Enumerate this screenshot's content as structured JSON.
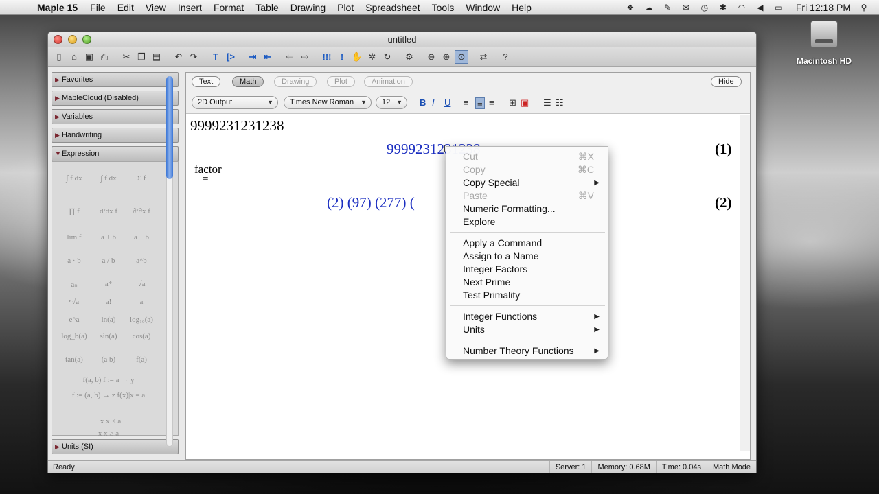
{
  "menubar": {
    "app_name": "Maple 15",
    "menus": [
      "File",
      "Edit",
      "View",
      "Insert",
      "Format",
      "Table",
      "Drawing",
      "Plot",
      "Spreadsheet",
      "Tools",
      "Window",
      "Help"
    ],
    "clock": "Fri 12:18 PM"
  },
  "desktop": {
    "drive_label": "Macintosh HD"
  },
  "window": {
    "title": "untitled"
  },
  "palette": {
    "sections": {
      "favorites": "Favorites",
      "maplecloud": "MapleCloud (Disabled)",
      "variables": "Variables",
      "handwriting": "Handwriting",
      "expression": "Expression",
      "units": "Units (SI)"
    },
    "expressions": [
      "∫ f dx",
      "∫ f dx",
      "Σ f",
      "∏ f",
      "d/dx f",
      "∂/∂x f",
      "lim f",
      "a + b",
      "a − b",
      "a · b",
      "a / b",
      "a^b",
      "aₙ",
      "a*",
      "√a",
      "ⁿ√a",
      "a!",
      "|a|",
      "e^a",
      "ln(a)",
      "log₁₀(a)",
      "log_b(a)",
      "sin(a)",
      "cos(a)",
      "tan(a)",
      "(a b)",
      "f(a)",
      "f(a, b)   f := a → y",
      "f := (a, b) → z   f(x)|x = a",
      "−x   x < a",
      "x   x ≥ a"
    ]
  },
  "context_bar": {
    "modes": [
      "Text",
      "Math",
      "Drawing",
      "Plot",
      "Animation"
    ],
    "hide": "Hide",
    "style": "2D Output",
    "font": "Times New Roman",
    "size": "12"
  },
  "document": {
    "input1": "9999231231238",
    "output1": "9999231231238",
    "label1": "(1)",
    "command": "factor",
    "equals": "=",
    "output2": "(2) (97) (277) (",
    "label2": "(2)"
  },
  "context_menu": {
    "cut": "Cut",
    "cut_sc": "⌘X",
    "copy": "Copy",
    "copy_sc": "⌘C",
    "copy_special": "Copy Special",
    "paste": "Paste",
    "paste_sc": "⌘V",
    "numeric_formatting": "Numeric Formatting...",
    "explore": "Explore",
    "apply_command": "Apply a Command",
    "assign_name": "Assign to a Name",
    "integer_factors": "Integer Factors",
    "next_prime": "Next Prime",
    "test_primality": "Test Primality",
    "integer_functions": "Integer Functions",
    "units": "Units",
    "number_theory": "Number Theory Functions"
  },
  "statusbar": {
    "ready": "Ready",
    "server": "Server: 1",
    "memory": "Memory: 0.68M",
    "time": "Time: 0.04s",
    "mode": "Math Mode"
  }
}
